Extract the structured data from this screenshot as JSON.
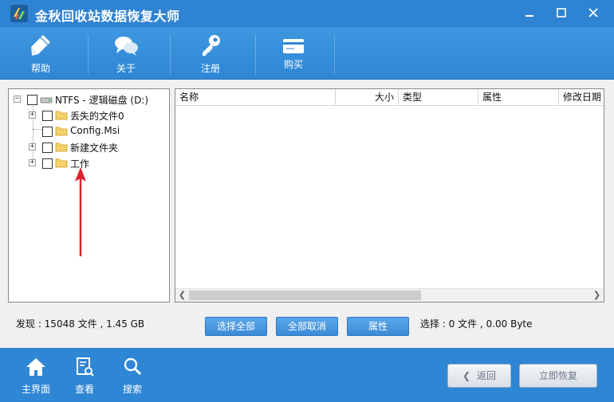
{
  "window": {
    "title": "金秋回收站数据恢复大师"
  },
  "toolbar": {
    "help": "帮助",
    "about": "关于",
    "register": "注册",
    "buy": "购买"
  },
  "tree": {
    "root": "NTFS - 逻辑磁盘 (D:)",
    "items": [
      "丢失的文件0",
      "Config.Msi",
      "新建文件夹",
      "工作"
    ]
  },
  "list": {
    "columns": [
      "名称",
      "大小",
      "类型",
      "属性",
      "修改日期"
    ]
  },
  "status": {
    "found": "发现 : 15048 文件 , 1.45 GB",
    "selected": "选择 : 0 文件 , 0.00 Byte"
  },
  "actions": {
    "select_all": "选择全部",
    "deselect_all": "全部取消",
    "properties": "属性"
  },
  "bottombar": {
    "home": "主界面",
    "view": "查看",
    "search": "搜索",
    "back": "返回",
    "recover": "立即恢复"
  },
  "colors": {
    "accent": "#2f86d4",
    "annotation_arrow": "#d9232e"
  }
}
